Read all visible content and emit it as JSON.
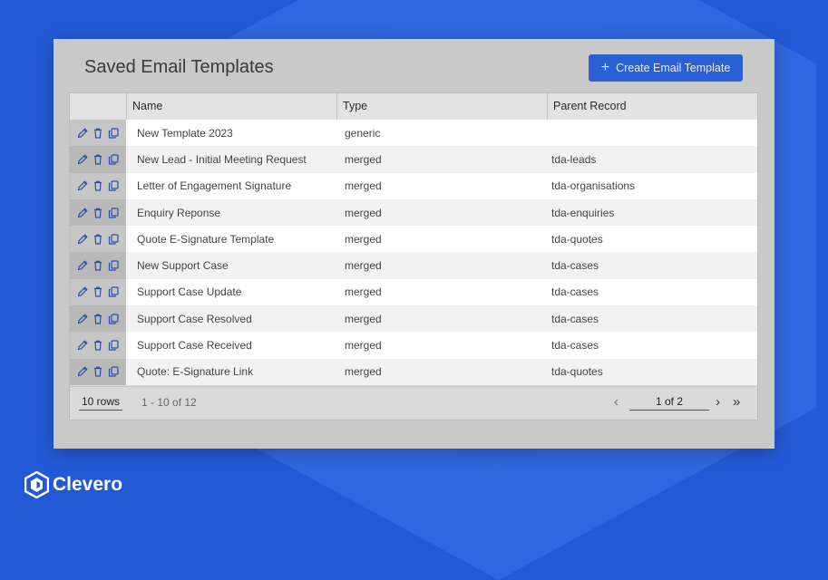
{
  "title": "Saved Email Templates",
  "create_button": "Create Email Template",
  "columns": {
    "name": "Name",
    "type": "Type",
    "parent": "Parent Record"
  },
  "rows": [
    {
      "name": "New Template 2023",
      "type": "generic",
      "parent": ""
    },
    {
      "name": "New Lead - Initial Meeting Request",
      "type": "merged",
      "parent": "tda-leads"
    },
    {
      "name": "Letter of Engagement Signature",
      "type": "merged",
      "parent": "tda-organisations"
    },
    {
      "name": "Enquiry Reponse",
      "type": "merged",
      "parent": "tda-enquiries"
    },
    {
      "name": "Quote E-Signature Template",
      "type": "merged",
      "parent": "tda-quotes"
    },
    {
      "name": "New Support Case",
      "type": "merged",
      "parent": "tda-cases"
    },
    {
      "name": "Support Case Update",
      "type": "merged",
      "parent": "tda-cases"
    },
    {
      "name": "Support Case Resolved",
      "type": "merged",
      "parent": "tda-cases"
    },
    {
      "name": "Support Case Received",
      "type": "merged",
      "parent": "tda-cases"
    },
    {
      "name": "Quote: E-Signature Link",
      "type": "merged",
      "parent": "tda-quotes"
    }
  ],
  "footer": {
    "rows_per_page": "10 rows",
    "range": "1 - 10 of 12",
    "page": "1 of 2",
    "prev": "‹",
    "next": "›",
    "last": "»"
  },
  "brand": {
    "name": "Clevero"
  },
  "icons": {
    "edit": "pencil-icon",
    "delete": "trash-icon",
    "duplicate": "copy-icon"
  },
  "colors": {
    "accent": "#2b5fd6",
    "background": "#2459d6",
    "icon": "#2b4fa8"
  }
}
